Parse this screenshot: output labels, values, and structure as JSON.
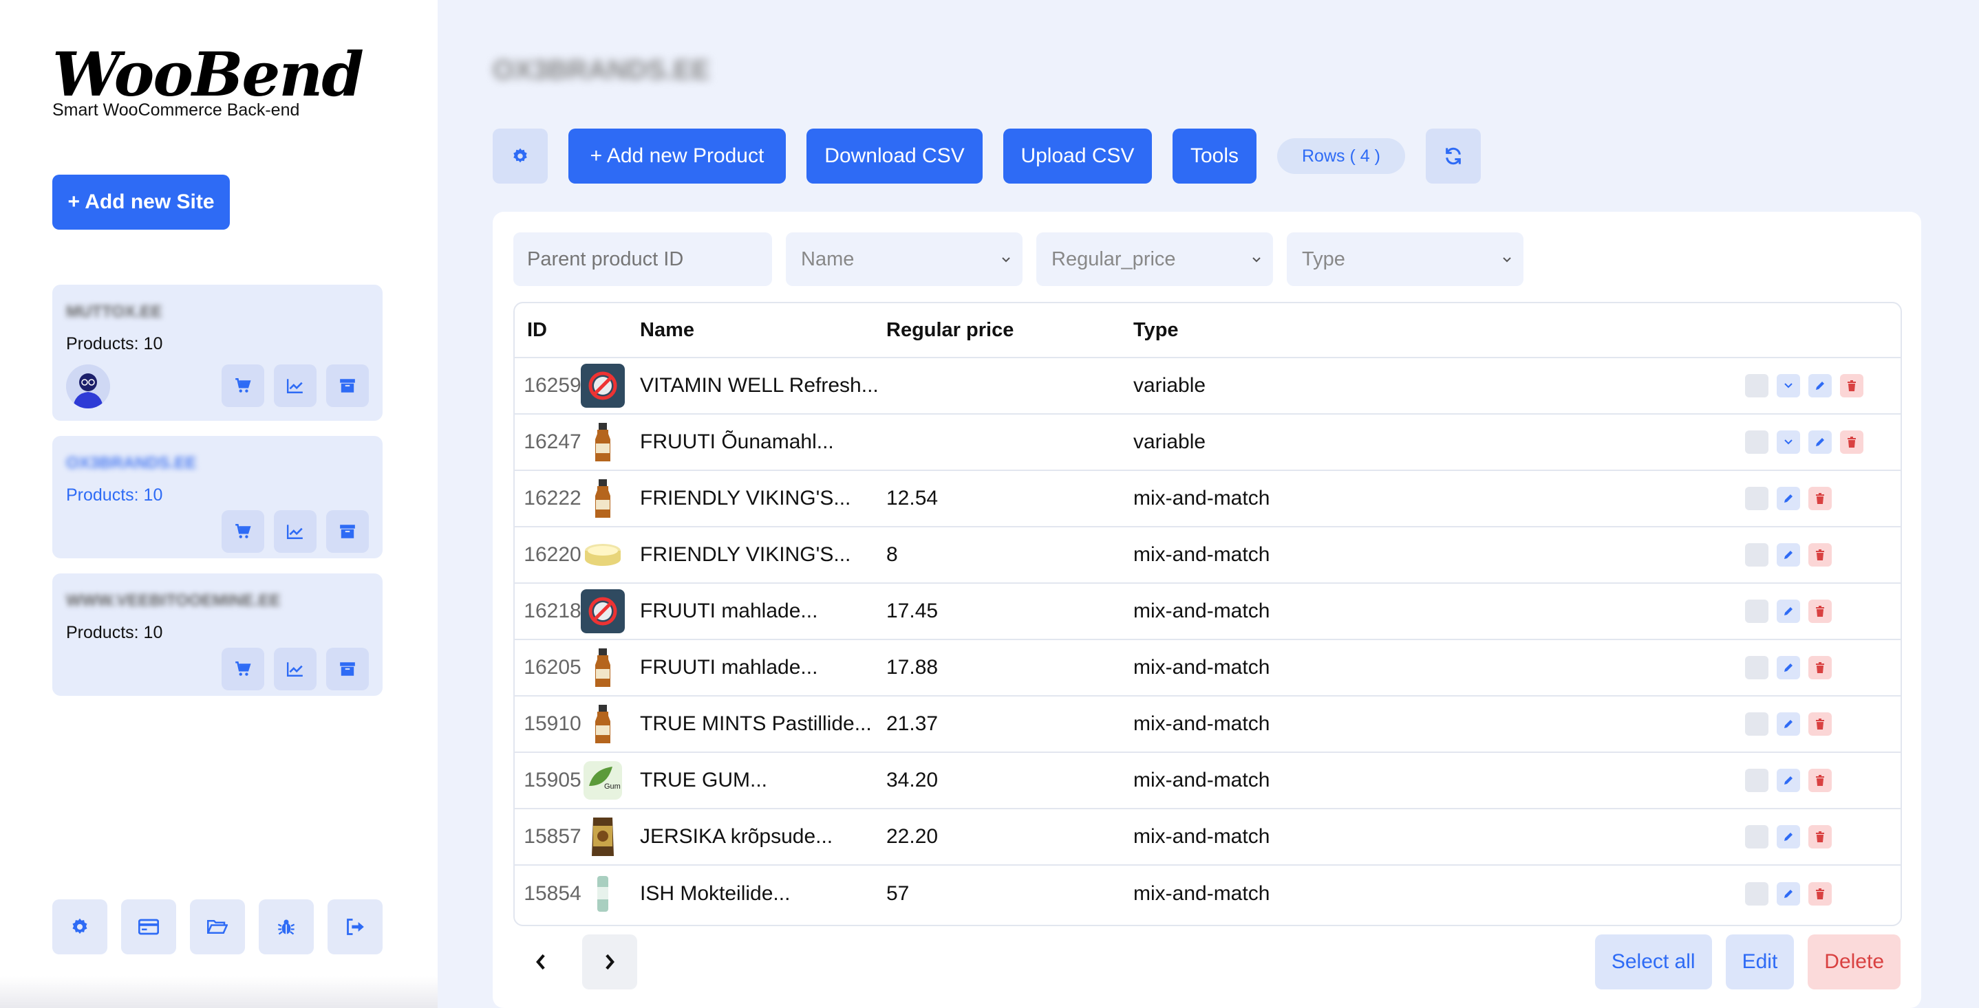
{
  "app": {
    "logo": "WooBend",
    "tagline": "Smart WooCommerce Back-end",
    "add_site_label": "+ Add new Site"
  },
  "sites": [
    {
      "name": "MUTTOX.EE",
      "products": "Products: 10",
      "blue": false
    },
    {
      "name": "OX3BRANDS.EE",
      "products": "Products: 10",
      "blue": true
    },
    {
      "name": "WWW.VEEBITOOEMINE.EE",
      "products": "Products: 10",
      "blue": false
    }
  ],
  "sidebar_bottom_icons": [
    "gear-icon",
    "credit-card-icon",
    "folder-open-icon",
    "bug-icon",
    "logout-icon"
  ],
  "main": {
    "title": "OX3BRANDS.EE",
    "toolbar": {
      "add_product": "+ Add new Product",
      "download_csv": "Download CSV",
      "upload_csv": "Upload CSV",
      "tools": "Tools",
      "rows": "Rows ( 4 )"
    },
    "filters": {
      "search_placeholder": "Parent product ID",
      "name": "Name",
      "price": "Regular_price",
      "type": "Type"
    },
    "table": {
      "headers": {
        "id": "ID",
        "name": "Name",
        "price": "Regular price",
        "type": "Type"
      },
      "rows": [
        {
          "id": "16259",
          "name": "VITAMIN WELL Refresh...",
          "price": "",
          "type": "variable",
          "image": "blocked-image-icon"
        },
        {
          "id": "16247",
          "name": "FRUUTI Õunamahl...",
          "price": "",
          "type": "variable",
          "image": "bottle-icon"
        },
        {
          "id": "16222",
          "name": "FRIENDLY VIKING'S...",
          "price": "12.54",
          "type": "mix-and-match",
          "image": "bottle-icon"
        },
        {
          "id": "16220",
          "name": "FRIENDLY VIKING'S...",
          "price": "8",
          "type": "mix-and-match",
          "image": "tin-icon"
        },
        {
          "id": "16218",
          "name": "FRUUTI mahlade...",
          "price": "17.45",
          "type": "mix-and-match",
          "image": "blocked-image-icon"
        },
        {
          "id": "16205",
          "name": "FRUUTI mahlade...",
          "price": "17.88",
          "type": "mix-and-match",
          "image": "bottle-icon"
        },
        {
          "id": "15910",
          "name": "TRUE MINTS Pastillide...",
          "price": "21.37",
          "type": "mix-and-match",
          "image": "bottle-icon"
        },
        {
          "id": "15905",
          "name": "TRUE GUM...",
          "price": "34.20",
          "type": "mix-and-match",
          "image": "gum-icon"
        },
        {
          "id": "15857",
          "name": "JERSIKA krõpsude...",
          "price": "22.20",
          "type": "mix-and-match",
          "image": "chips-bag-icon"
        },
        {
          "id": "15854",
          "name": "ISH Mokteilide...",
          "price": "57",
          "type": "mix-and-match",
          "image": "can-icon"
        }
      ]
    },
    "bulk": {
      "select_all": "Select all",
      "edit": "Edit",
      "delete": "Delete"
    }
  },
  "colors": {
    "accent": "#2e6bf5",
    "danger": "#d94141",
    "panel": "#eef2fc",
    "site_card": "#e6ecfb"
  }
}
